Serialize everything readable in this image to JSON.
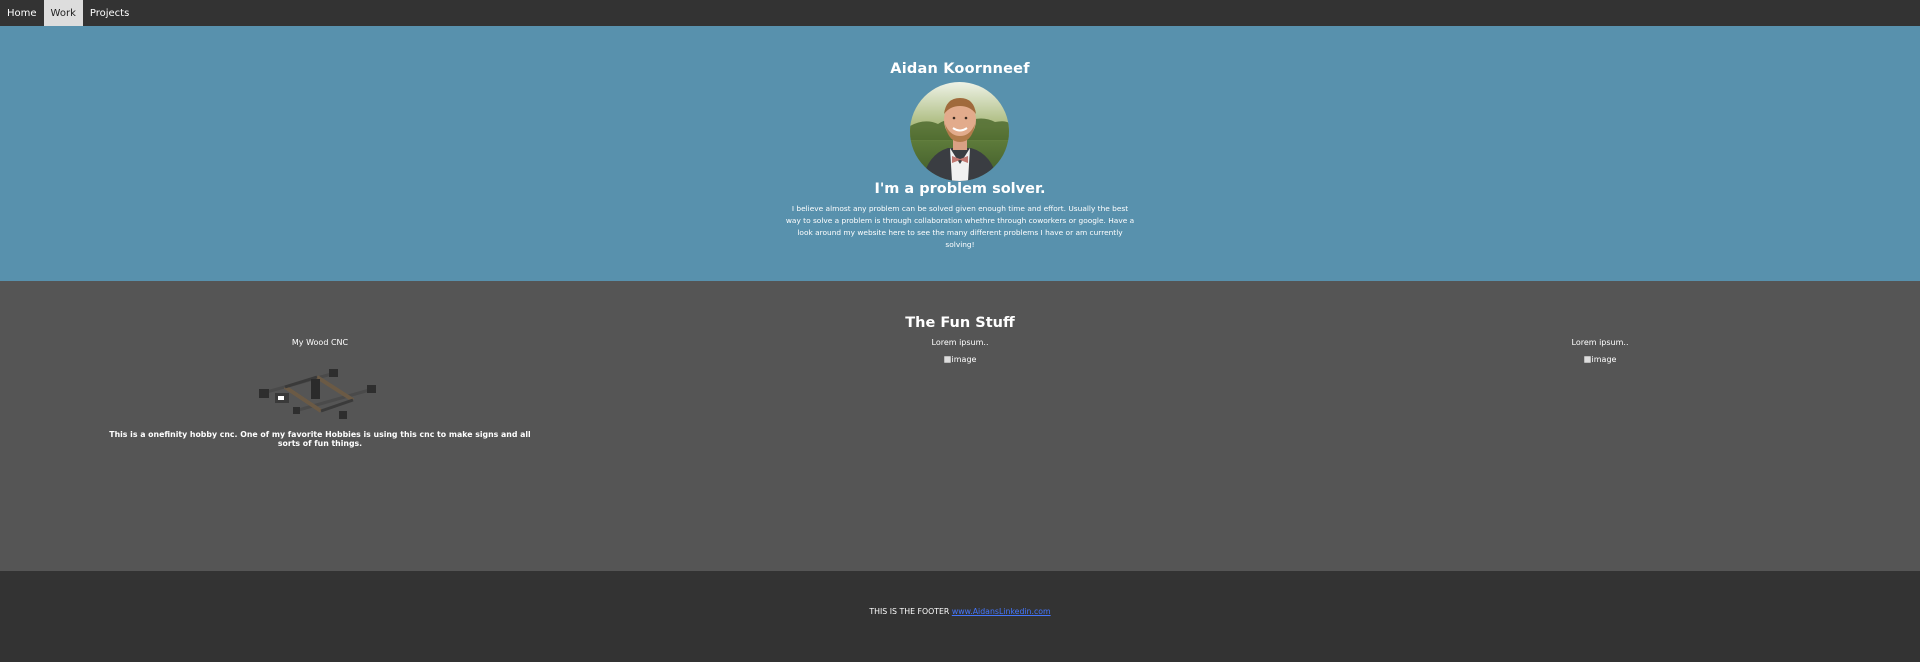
{
  "nav": {
    "items": [
      {
        "label": "Home"
      },
      {
        "label": "Work"
      },
      {
        "label": "Projects"
      }
    ]
  },
  "hero": {
    "name": "Aidan Koornneef",
    "tagline": "I'm a problem solver.",
    "description": "I believe almost any problem can be solved given enough time and effort. Usually the best way to solve a problem is through collaboration whethre through coworkers or google. Have a look around my website here to see the many different problems I have or am currently solving!"
  },
  "fun": {
    "title": "The Fun Stuff",
    "columns": [
      {
        "title": "My Wood CNC",
        "description": "This is a onefinity hobby cnc. One of my favorite Hobbies is using this cnc to make signs and all sorts of fun things."
      },
      {
        "title": "Lorem ipsum..",
        "image_alt": "image"
      },
      {
        "title": "Lorem ipsum..",
        "image_alt": "image"
      }
    ]
  },
  "footer": {
    "text": "THIS IS THE FOOTER",
    "link_text": "www.AidansLinkedin.com"
  },
  "colors": {
    "nav_bg": "#333333",
    "nav_active_bg": "#dddddd",
    "hero_bg": "#5891ad",
    "fun_bg": "#555555",
    "footer_bg": "#333333",
    "link": "#4477ff"
  },
  "icons": {
    "broken_image": "broken-image-icon"
  }
}
